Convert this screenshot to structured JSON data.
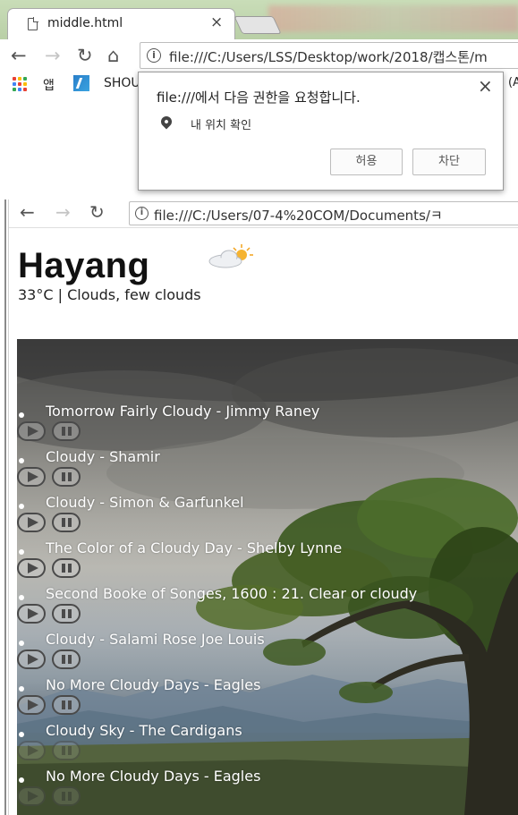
{
  "browser1": {
    "tab_title": "middle.html",
    "tab_close": "×",
    "url": "file:///C:/Users/LSS/Desktop/work/2018/캡스톤/m",
    "bookmarks": {
      "apps_label": "앱",
      "shou_label": "SHOU",
      "right_label": "(Ac"
    }
  },
  "permission_popup": {
    "title": "file:///에서 다음 권한을 요청합니다.",
    "item": "내 위치 확인",
    "allow_label": "허용",
    "block_label": "차단",
    "close": "×"
  },
  "browser2": {
    "url": "file:///C:/Users/07-4%20COM/Documents/ㅋ"
  },
  "weather": {
    "city": "Hayang",
    "description": "33°C | Clouds, few clouds",
    "icon": "partly-cloudy-icon"
  },
  "songs": [
    {
      "title": "Tomorrow Fairly Cloudy - Jimmy Raney"
    },
    {
      "title": "Cloudy - Shamir"
    },
    {
      "title": "Cloudy - Simon & Garfunkel"
    },
    {
      "title": "The Color of a Cloudy Day - Shelby Lynne"
    },
    {
      "title": "Second Booke of Songes, 1600 : 21. Clear or cloudy"
    },
    {
      "title": "Cloudy - Salami Rose Joe Louis"
    },
    {
      "title": "No More Cloudy Days - Eagles"
    },
    {
      "title": "Cloudy Sky - The Cardigans"
    },
    {
      "title": "No More Cloudy Days - Eagles"
    }
  ]
}
